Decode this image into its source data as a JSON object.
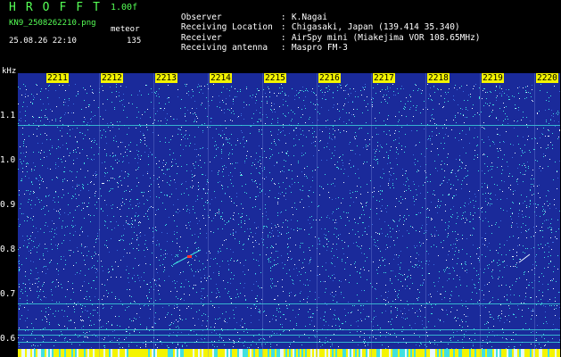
{
  "header": {
    "app_name": "HROFFT",
    "version": "1.00f",
    "filename": "KN9_2508262210.png",
    "mode": "meteor",
    "datetime": "25.08.26 22:10",
    "count": "135"
  },
  "info": [
    {
      "label": "Observer",
      "value": "K.Nagai"
    },
    {
      "label": "Receiving Location",
      "value": "Chigasaki, Japan (139.414 35.340)"
    },
    {
      "label": "Receiver",
      "value": "AirSpy mini (Miakejima VOR 108.65MHz)"
    },
    {
      "label": "Receiving antenna",
      "value": "Maspro FM-3"
    }
  ],
  "spectrogram": {
    "y_unit": "kHz",
    "y_ticks": [
      "1.1",
      "1.0",
      "0.9",
      "0.8",
      "0.7",
      "0.6"
    ],
    "x_labels": [
      "2211",
      "2212",
      "2213",
      "2214",
      "2215",
      "2216",
      "2217",
      "2218",
      "2219",
      "2220"
    ],
    "colors": {
      "background": "#1a2a9a",
      "noise_cyan": "#40e0e0",
      "noise_white": "#e8f8ff",
      "label_bg": "#f4f400",
      "meteor_red": "#ff3030"
    }
  }
}
